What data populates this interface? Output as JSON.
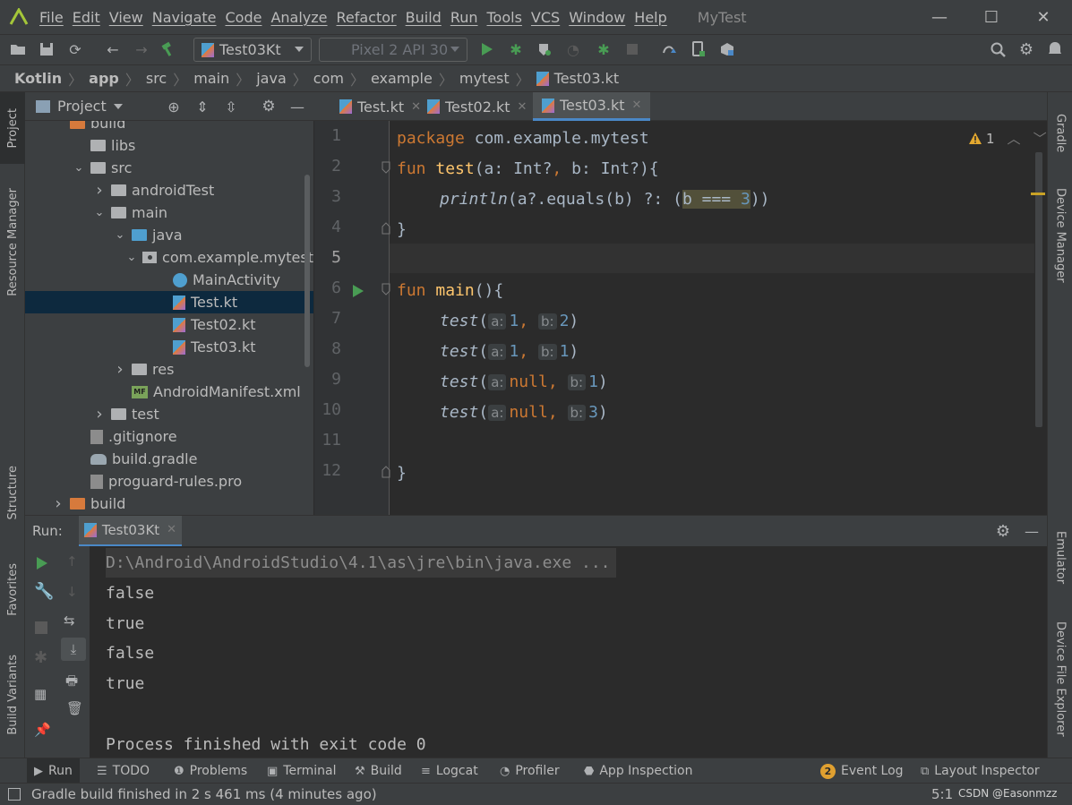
{
  "menubar": {
    "items": [
      "File",
      "Edit",
      "View",
      "Navigate",
      "Code",
      "Analyze",
      "Refactor",
      "Build",
      "Run",
      "Tools",
      "VCS",
      "Window",
      "Help"
    ],
    "project_title": "MyTest"
  },
  "toolbar": {
    "run_config": "Test03Kt",
    "device": "Pixel 2 API 30"
  },
  "breadcrumb": [
    "Kotlin",
    "app",
    "src",
    "main",
    "java",
    "com",
    "example",
    "mytest",
    "Test03.kt"
  ],
  "left_stripe": {
    "project": "Project",
    "resource_manager": "Resource Manager",
    "structure": "Structure",
    "favorites": "Favorites",
    "build_variants": "Build Variants"
  },
  "right_stripe": {
    "gradle": "Gradle",
    "device_manager": "Device Manager",
    "emulator": "Emulator",
    "device_file_explorer": "Device File Explorer"
  },
  "project_panel": {
    "title": "Project",
    "tree": [
      {
        "label": "build",
        "indent": 0,
        "type": "folder-orange",
        "chev": ""
      },
      {
        "label": "libs",
        "indent": 1,
        "type": "folder",
        "chev": ""
      },
      {
        "label": "src",
        "indent": 1,
        "type": "folder",
        "chev": "down"
      },
      {
        "label": "androidTest",
        "indent": 2,
        "type": "folder",
        "chev": "right"
      },
      {
        "label": "main",
        "indent": 2,
        "type": "folder",
        "chev": "down"
      },
      {
        "label": "java",
        "indent": 3,
        "type": "folder-blue",
        "chev": "down"
      },
      {
        "label": "com.example.mytest",
        "indent": 4,
        "type": "package",
        "chev": "down"
      },
      {
        "label": "MainActivity",
        "indent": 5,
        "type": "activity",
        "chev": ""
      },
      {
        "label": "Test.kt",
        "indent": 5,
        "type": "kt",
        "chev": "",
        "selected": true
      },
      {
        "label": "Test02.kt",
        "indent": 5,
        "type": "kt",
        "chev": ""
      },
      {
        "label": "Test03.kt",
        "indent": 5,
        "type": "kt",
        "chev": ""
      },
      {
        "label": "res",
        "indent": 3,
        "type": "folder",
        "chev": "right"
      },
      {
        "label": "AndroidManifest.xml",
        "indent": 3,
        "type": "manifest",
        "chev": ""
      },
      {
        "label": "test",
        "indent": 2,
        "type": "folder",
        "chev": "right"
      },
      {
        "label": ".gitignore",
        "indent": 1,
        "type": "file",
        "chev": ""
      },
      {
        "label": "build.gradle",
        "indent": 1,
        "type": "gradle",
        "chev": ""
      },
      {
        "label": "proguard-rules.pro",
        "indent": 1,
        "type": "file",
        "chev": ""
      },
      {
        "label": "build",
        "indent": 0,
        "type": "folder-orange",
        "chev": "right"
      }
    ]
  },
  "editor_tabs": [
    {
      "label": "Test.kt",
      "active": false
    },
    {
      "label": "Test02.kt",
      "active": false
    },
    {
      "label": "Test03.kt",
      "active": true
    }
  ],
  "editor": {
    "warning_count": "1",
    "line_numbers": [
      "1",
      "2",
      "3",
      "4",
      "5",
      "6",
      "7",
      "8",
      "9",
      "10",
      "11",
      "12"
    ],
    "current_line": "5",
    "code": {
      "l1_kw": "package",
      "l1_rest": " com.example.mytest",
      "l2_kw": "fun",
      "l2_fn": "test",
      "l2_a": "(a: Int?",
      "l2_comma": ",",
      "l2_b": " b: Int?){",
      "l3_fn": "println",
      "l3_a": "(a?.equals(b) ?: (",
      "l3_hl_b": "b === ",
      "l3_hl_num": "3",
      "l3_end": "))",
      "l4": "}",
      "l6_kw": "fun",
      "l6_fn": "main",
      "l6_rest": "(){",
      "call_fn": "test",
      "paren_open": "(",
      "paren_close": ")",
      "hint_a": "a:",
      "hint_b": "b:",
      "comma": ",",
      "null_kw": "null",
      "l7_a": "1",
      "l7_b": "2",
      "l8_a": "1",
      "l8_b": "1",
      "l9_b": "1",
      "l10_b": "3",
      "l12": "}"
    }
  },
  "run_panel": {
    "label": "Run:",
    "tab": "Test03Kt",
    "console": [
      "D:\\Android\\AndroidStudio\\4.1\\as\\jre\\bin\\java.exe ...",
      "false",
      "true",
      "false",
      "true",
      "",
      "Process finished with exit code 0"
    ]
  },
  "bottom_tools": {
    "run": "Run",
    "todo": "TODO",
    "problems": "Problems",
    "terminal": "Terminal",
    "build": "Build",
    "logcat": "Logcat",
    "profiler": "Profiler",
    "app_inspection": "App Inspection",
    "event_log_count": "2",
    "event_log": "Event Log",
    "layout_inspector": "Layout Inspector"
  },
  "statusbar": {
    "message": "Gradle build finished in 2 s 461 ms (4 minutes ago)",
    "position": "5:1",
    "watermark": "CSDN @Easonmzz"
  },
  "colors": {
    "accent": "#4a88c7",
    "run_green": "#499c54",
    "keyword": "#cc7832",
    "function": "#ffc66d",
    "number": "#6897bb"
  }
}
